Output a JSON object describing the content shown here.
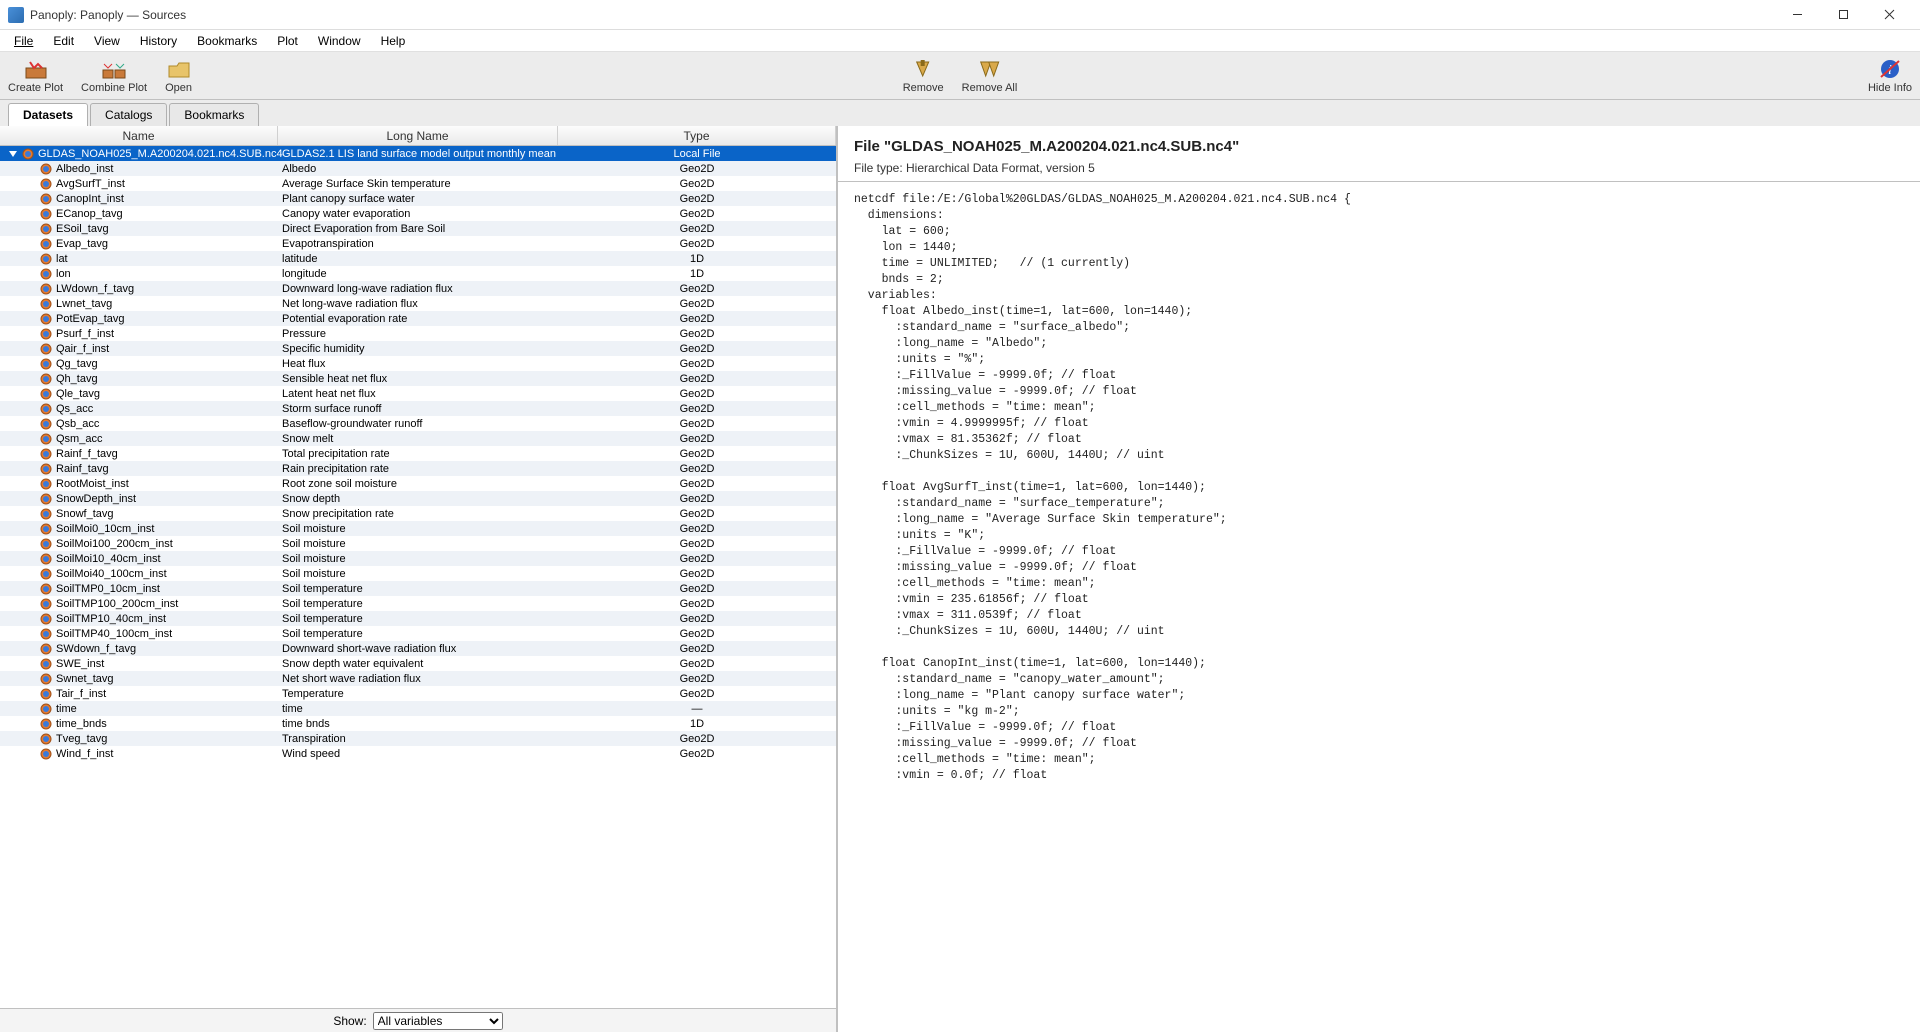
{
  "window": {
    "title": "Panoply: Panoply — Sources"
  },
  "menu": {
    "file": "File",
    "edit": "Edit",
    "view": "View",
    "history": "History",
    "bookmarks": "Bookmarks",
    "plot": "Plot",
    "window": "Window",
    "help": "Help"
  },
  "toolbar": {
    "create_plot": "Create Plot",
    "combine_plot": "Combine Plot",
    "open": "Open",
    "remove": "Remove",
    "remove_all": "Remove All",
    "hide_info": "Hide Info"
  },
  "tabs": {
    "datasets": "Datasets",
    "catalogs": "Catalogs",
    "bookmarks": "Bookmarks"
  },
  "cols": {
    "name": "Name",
    "long": "Long Name",
    "type": "Type"
  },
  "rows": [
    {
      "name": "GLDAS_NOAH025_M.A200204.021.nc4.SUB.nc4",
      "long": "GLDAS2.1 LIS land surface model output monthly mean",
      "type": "Local File",
      "selected": true,
      "root": true
    },
    {
      "name": "Albedo_inst",
      "long": "Albedo",
      "type": "Geo2D"
    },
    {
      "name": "AvgSurfT_inst",
      "long": "Average Surface Skin temperature",
      "type": "Geo2D"
    },
    {
      "name": "CanopInt_inst",
      "long": "Plant canopy surface water",
      "type": "Geo2D"
    },
    {
      "name": "ECanop_tavg",
      "long": "Canopy water evaporation",
      "type": "Geo2D"
    },
    {
      "name": "ESoil_tavg",
      "long": "Direct Evaporation from Bare Soil",
      "type": "Geo2D"
    },
    {
      "name": "Evap_tavg",
      "long": "Evapotranspiration",
      "type": "Geo2D"
    },
    {
      "name": "lat",
      "long": "latitude",
      "type": "1D"
    },
    {
      "name": "lon",
      "long": "longitude",
      "type": "1D"
    },
    {
      "name": "LWdown_f_tavg",
      "long": "Downward long-wave radiation flux",
      "type": "Geo2D"
    },
    {
      "name": "Lwnet_tavg",
      "long": "Net long-wave radiation flux",
      "type": "Geo2D"
    },
    {
      "name": "PotEvap_tavg",
      "long": "Potential evaporation rate",
      "type": "Geo2D"
    },
    {
      "name": "Psurf_f_inst",
      "long": "Pressure",
      "type": "Geo2D"
    },
    {
      "name": "Qair_f_inst",
      "long": "Specific humidity",
      "type": "Geo2D"
    },
    {
      "name": "Qg_tavg",
      "long": "Heat flux",
      "type": "Geo2D"
    },
    {
      "name": "Qh_tavg",
      "long": "Sensible heat net flux",
      "type": "Geo2D"
    },
    {
      "name": "Qle_tavg",
      "long": "Latent heat net flux",
      "type": "Geo2D"
    },
    {
      "name": "Qs_acc",
      "long": "Storm surface runoff",
      "type": "Geo2D"
    },
    {
      "name": "Qsb_acc",
      "long": "Baseflow-groundwater runoff",
      "type": "Geo2D"
    },
    {
      "name": "Qsm_acc",
      "long": "Snow melt",
      "type": "Geo2D"
    },
    {
      "name": "Rainf_f_tavg",
      "long": "Total precipitation rate",
      "type": "Geo2D"
    },
    {
      "name": "Rainf_tavg",
      "long": "Rain precipitation rate",
      "type": "Geo2D"
    },
    {
      "name": "RootMoist_inst",
      "long": "Root zone soil moisture",
      "type": "Geo2D"
    },
    {
      "name": "SnowDepth_inst",
      "long": "Snow depth",
      "type": "Geo2D"
    },
    {
      "name": "Snowf_tavg",
      "long": "Snow precipitation rate",
      "type": "Geo2D"
    },
    {
      "name": "SoilMoi0_10cm_inst",
      "long": "Soil moisture",
      "type": "Geo2D"
    },
    {
      "name": "SoilMoi100_200cm_inst",
      "long": "Soil moisture",
      "type": "Geo2D"
    },
    {
      "name": "SoilMoi10_40cm_inst",
      "long": "Soil moisture",
      "type": "Geo2D"
    },
    {
      "name": "SoilMoi40_100cm_inst",
      "long": "Soil moisture",
      "type": "Geo2D"
    },
    {
      "name": "SoilTMP0_10cm_inst",
      "long": "Soil temperature",
      "type": "Geo2D"
    },
    {
      "name": "SoilTMP100_200cm_inst",
      "long": "Soil temperature",
      "type": "Geo2D"
    },
    {
      "name": "SoilTMP10_40cm_inst",
      "long": "Soil temperature",
      "type": "Geo2D"
    },
    {
      "name": "SoilTMP40_100cm_inst",
      "long": "Soil temperature",
      "type": "Geo2D"
    },
    {
      "name": "SWdown_f_tavg",
      "long": "Downward short-wave radiation flux",
      "type": "Geo2D"
    },
    {
      "name": "SWE_inst",
      "long": "Snow depth water equivalent",
      "type": "Geo2D"
    },
    {
      "name": "Swnet_tavg",
      "long": "Net short wave radiation flux",
      "type": "Geo2D"
    },
    {
      "name": "Tair_f_inst",
      "long": "Temperature",
      "type": "Geo2D"
    },
    {
      "name": "time",
      "long": "time",
      "type": "—"
    },
    {
      "name": "time_bnds",
      "long": "time bnds",
      "type": "1D"
    },
    {
      "name": "Tveg_tavg",
      "long": "Transpiration",
      "type": "Geo2D"
    },
    {
      "name": "Wind_f_inst",
      "long": "Wind speed",
      "type": "Geo2D"
    }
  ],
  "filter": {
    "label": "Show:",
    "value": "All variables"
  },
  "info": {
    "header": "File \"GLDAS_NOAH025_M.A200204.021.nc4.SUB.nc4\"",
    "subtype": "File type: Hierarchical Data Format, version 5",
    "dump": "netcdf file:/E:/Global%20GLDAS/GLDAS_NOAH025_M.A200204.021.nc4.SUB.nc4 {\n  dimensions:\n    lat = 600;\n    lon = 1440;\n    time = UNLIMITED;   // (1 currently)\n    bnds = 2;\n  variables:\n    float Albedo_inst(time=1, lat=600, lon=1440);\n      :standard_name = \"surface_albedo\";\n      :long_name = \"Albedo\";\n      :units = \"%\";\n      :_FillValue = -9999.0f; // float\n      :missing_value = -9999.0f; // float\n      :cell_methods = \"time: mean\";\n      :vmin = 4.9999995f; // float\n      :vmax = 81.35362f; // float\n      :_ChunkSizes = 1U, 600U, 1440U; // uint\n\n    float AvgSurfT_inst(time=1, lat=600, lon=1440);\n      :standard_name = \"surface_temperature\";\n      :long_name = \"Average Surface Skin temperature\";\n      :units = \"K\";\n      :_FillValue = -9999.0f; // float\n      :missing_value = -9999.0f; // float\n      :cell_methods = \"time: mean\";\n      :vmin = 235.61856f; // float\n      :vmax = 311.0539f; // float\n      :_ChunkSizes = 1U, 600U, 1440U; // uint\n\n    float CanopInt_inst(time=1, lat=600, lon=1440);\n      :standard_name = \"canopy_water_amount\";\n      :long_name = \"Plant canopy surface water\";\n      :units = \"kg m-2\";\n      :_FillValue = -9999.0f; // float\n      :missing_value = -9999.0f; // float\n      :cell_methods = \"time: mean\";\n      :vmin = 0.0f; // float"
  }
}
